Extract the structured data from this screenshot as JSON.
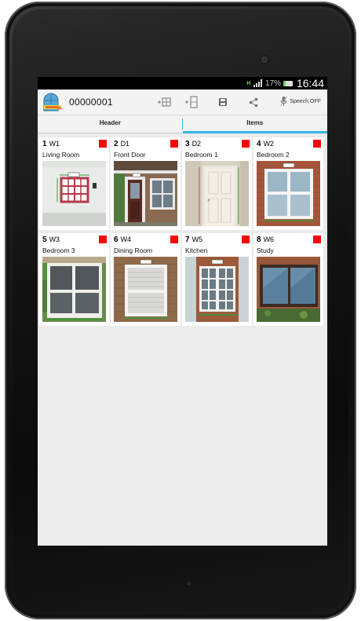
{
  "status_bar": {
    "network": "H",
    "battery_percent": "17%",
    "time": "16:44"
  },
  "action_bar": {
    "title": "00000001",
    "speech_label": "Speech OFF",
    "icons": [
      "app-logo-icon",
      "add-window-icon",
      "add-door-icon",
      "save-icon",
      "share-icon",
      "microphone-off-icon"
    ]
  },
  "tabs": [
    {
      "label": "Header",
      "active": false
    },
    {
      "label": "Items",
      "active": true
    }
  ],
  "colors": {
    "accent": "#33b5e5",
    "status_red": "#ff0000"
  },
  "items": [
    {
      "num": "1",
      "code": "W1",
      "room": "Living Room",
      "status_color": "#ff0000",
      "photo": "window-white-wall"
    },
    {
      "num": "2",
      "code": "D1",
      "room": "Front Door",
      "status_color": "#ff0000",
      "photo": "door-brown"
    },
    {
      "num": "3",
      "code": "D2",
      "room": "Bedroom 1",
      "status_color": "#ff0000",
      "photo": "door-white"
    },
    {
      "num": "4",
      "code": "W2",
      "room": "Bedroom 2",
      "status_color": "#ff0000",
      "photo": "window-brick"
    },
    {
      "num": "5",
      "code": "W3",
      "room": "Bedroom 3",
      "status_color": "#ff0000",
      "photo": "window-white-frame"
    },
    {
      "num": "6",
      "code": "W4",
      "room": "Dining Room",
      "status_color": "#ff0000",
      "photo": "window-sash"
    },
    {
      "num": "7",
      "code": "W5",
      "room": "Kitchen",
      "status_color": "#ff0000",
      "photo": "window-georgian"
    },
    {
      "num": "8",
      "code": "W6",
      "room": "Study",
      "status_color": "#ff0000",
      "photo": "window-dark"
    }
  ]
}
